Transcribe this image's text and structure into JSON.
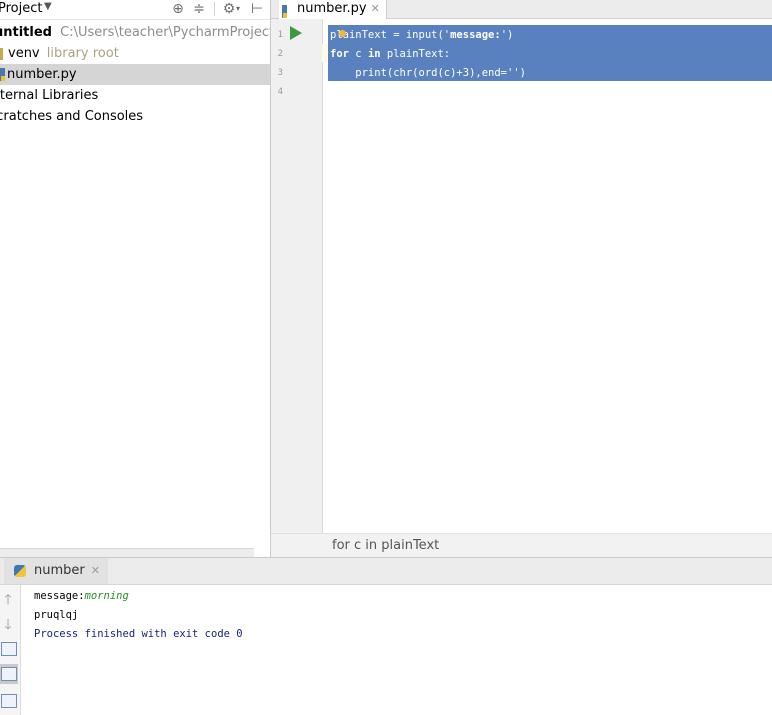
{
  "project_panel": {
    "title": "Project",
    "tree": {
      "root_name": "untitled",
      "root_path": "C:\\Users\\teacher\\PycharmProjects\\untitled",
      "venv_name": "venv",
      "venv_note": "library root",
      "file_name": "number.py",
      "external_libraries": "External Libraries",
      "scratches": "Scratches and Consoles"
    }
  },
  "editor": {
    "tab_label": "number.py",
    "line_numbers": [
      "1",
      "2",
      "3",
      "4"
    ],
    "code": {
      "line1": {
        "a": "plainText = input('",
        "b": "message:",
        "c": "')"
      },
      "line2": {
        "kw1": "for",
        "mid": " c ",
        "kw2": "in",
        "end": " plainText:"
      },
      "line3": "    print(chr(ord(c)+3),end='')"
    },
    "breadcrumb": "for c in plainText"
  },
  "run_panel": {
    "tab_label": "number",
    "console": {
      "prompt": "message:",
      "input": "morning",
      "output": "pruqlqj",
      "exit": "Process finished with exit code 0"
    }
  },
  "icons": {
    "run": "run-triangle-icon",
    "locate": "crosshair-icon",
    "collapse": "collapse-all-icon",
    "settings": "gear-icon",
    "hide": "hide-panel-icon"
  },
  "colors": {
    "selection": "#5a81bf",
    "run_green": "#3c9a3c",
    "console_input": "#2e8b2e",
    "exit_text": "#1a237e"
  }
}
